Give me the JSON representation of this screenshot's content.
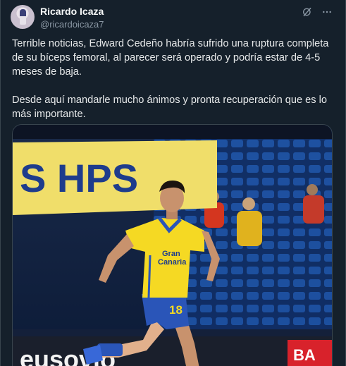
{
  "tweet": {
    "author_name": "Ricardo Icaza",
    "author_handle": "@ricardoicaza7",
    "text": "Terrible noticias, Edward Cedeño habría sufrido una ruptura completa de su bíceps femoral, al parecer será operado y podría estar de 4-5 meses de baja.\n\nDesde aquí mandarle mucho ánimos y pronta recuperación que es lo más importante."
  },
  "icons": {
    "grok": "grok-icon",
    "more": "more-icon"
  },
  "media": {
    "banner_text": "S HPS",
    "board_text": "eusovio",
    "board_tag": "BA",
    "shirt_text_1": "Gran",
    "shirt_text_2": "Canaria",
    "shirt_number": "18",
    "colors": {
      "jersey": "#f5d923",
      "shorts": "#2a55b8",
      "banner": "#f0de6a",
      "banner_text": "#1e3c8c"
    }
  }
}
